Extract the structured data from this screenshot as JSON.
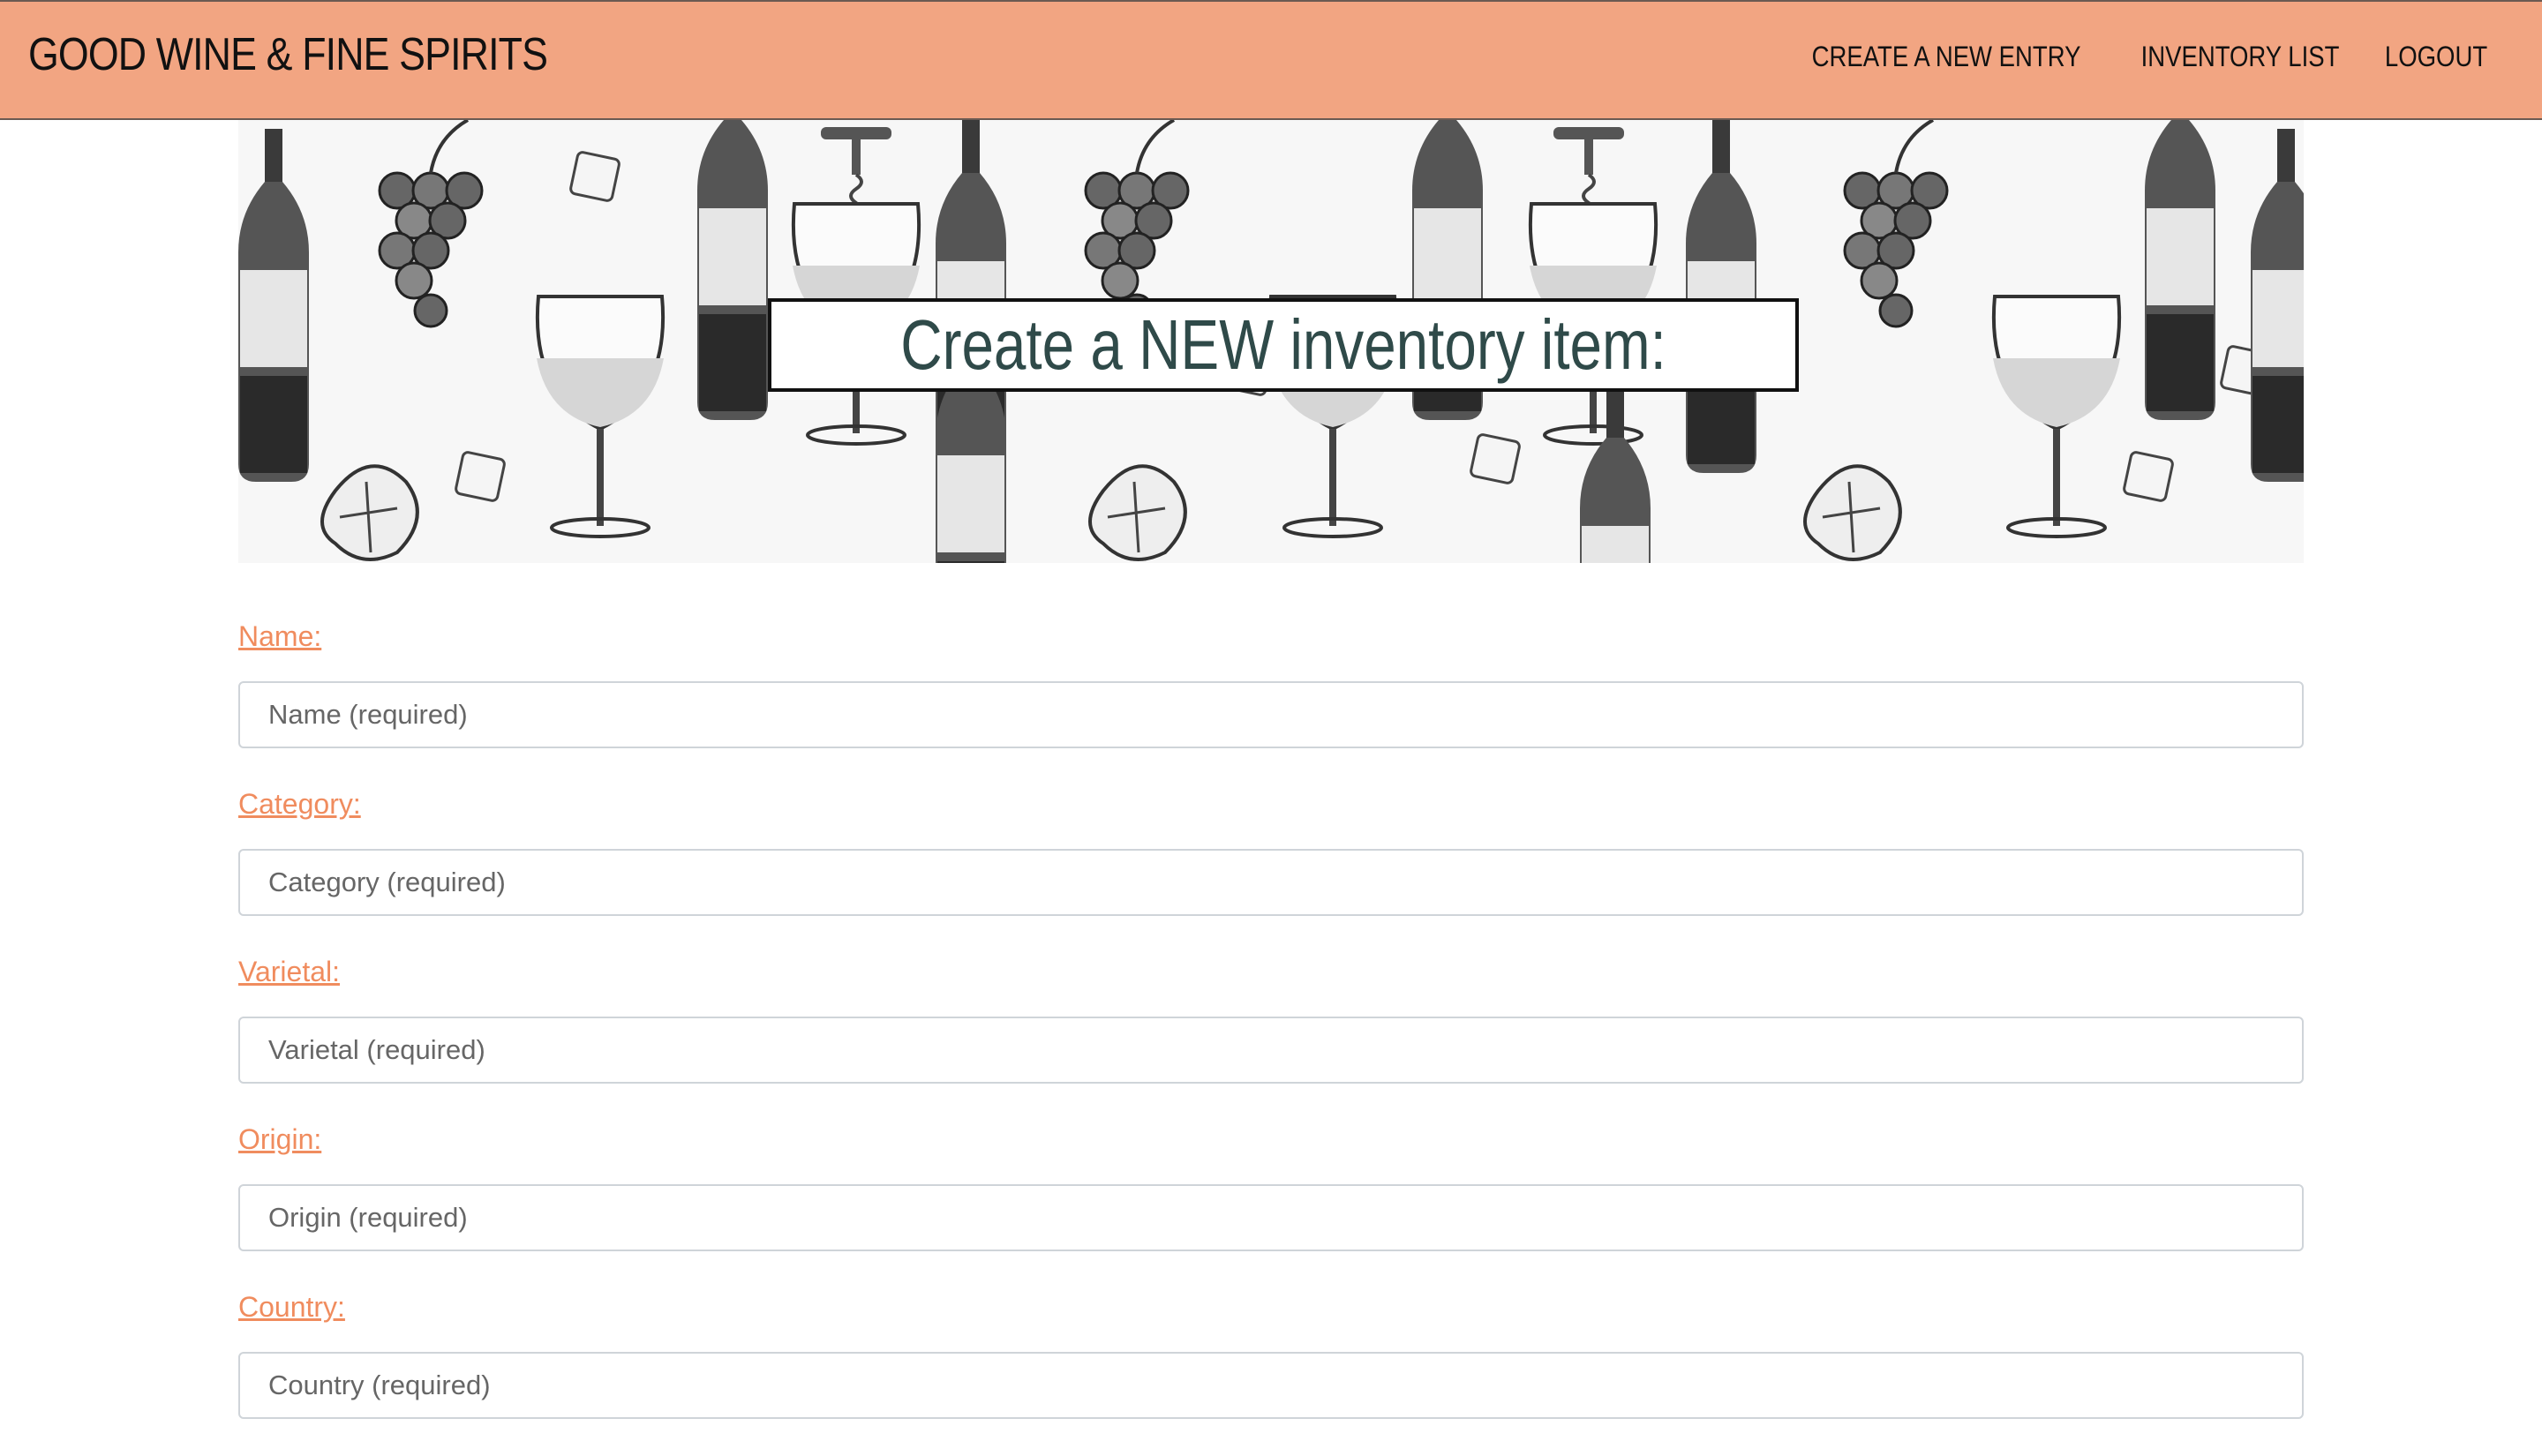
{
  "navbar": {
    "brand": "GOOD WINE & FINE SPIRITS",
    "links": [
      "CREATE A NEW ENTRY",
      "INVENTORY LIST",
      "LOGOUT"
    ],
    "background": "#f2a582"
  },
  "hero": {
    "title": "Create a NEW inventory item:",
    "title_color": "#2f4a49",
    "background_pattern": "wine-bottles-grapes-glasses-sketch"
  },
  "form": {
    "fields": [
      {
        "label": "Name:",
        "placeholder": "Name (required)"
      },
      {
        "label": "Category:",
        "placeholder": "Category (required)"
      },
      {
        "label": "Varietal:",
        "placeholder": "Varietal (required)"
      },
      {
        "label": "Origin:",
        "placeholder": "Origin (required)"
      },
      {
        "label": "Country:",
        "placeholder": "Country (required)"
      }
    ],
    "label_color": "#f08c5e"
  }
}
